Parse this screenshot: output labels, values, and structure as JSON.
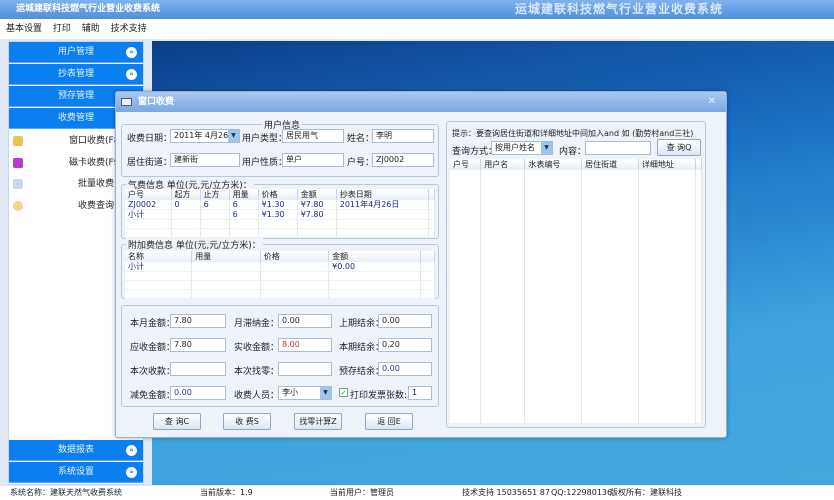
{
  "app": {
    "title": "运城建联科技燃气行业营业收费系统",
    "banner_title": "运城建联科技燃气行业营业收费系统"
  },
  "menu": [
    "基本设置",
    "打印",
    "辅助",
    "技术支持"
  ],
  "sidebar": {
    "sections_top": [
      "用户管理",
      "抄表管理",
      "预存管理",
      "收费管理"
    ],
    "items": [
      {
        "label": "窗口收费(F8)",
        "icon": "pen-icon"
      },
      {
        "label": "磁卡收费(F9)",
        "icon": "card-icon"
      },
      {
        "label": "批量收费",
        "icon": "document-icon"
      },
      {
        "label": "收费查询",
        "icon": "chat-icon"
      }
    ],
    "sections_bottom": [
      "数据报表",
      "系统设置"
    ],
    "accent": "#0a7ff0"
  },
  "dialog": {
    "title": "窗口收费",
    "user_info": {
      "title": "用户信息",
      "date_label": "收费日期：",
      "date_value": "2011年 4月26日",
      "type_label": "用户类型：",
      "type_value": "居民用气",
      "name_label": "姓名：",
      "name_value": "李明",
      "street_label": "居住街道：",
      "street_value": "建新街",
      "nature_label": "用户性质：",
      "nature_value": "单户",
      "account_label": "户号：",
      "account_value": "ZJ0002"
    },
    "gas_fee": {
      "title": "气费信息 单位(元,元/立方米)：",
      "columns": [
        "户号",
        "起方",
        "止方",
        "用量",
        "价格",
        "金额",
        "抄表日期"
      ],
      "rows": [
        [
          "ZJ0002",
          "0",
          "6",
          "6",
          "¥1.30",
          "¥7.80",
          "2011年4月26日"
        ],
        [
          "小计",
          "",
          "",
          "6",
          "¥1.30",
          "¥7.80",
          ""
        ]
      ]
    },
    "extra_fee": {
      "title": "附加费信息 单位(元,元/立方米)：",
      "columns": [
        "名称",
        "用量",
        "价格",
        "金额"
      ],
      "rows": [
        [
          "小计",
          "",
          "",
          "¥0.00"
        ]
      ]
    },
    "summary": {
      "month_amount_label": "本月金额：",
      "month_amount": "7.80",
      "late_fee_label": "月滞纳金：",
      "late_fee": "0.00",
      "last_balance_label": "上期结余：",
      "last_balance": "0.00",
      "due_label": "应收金额：",
      "due": "7.80",
      "paid_label": "实收金额：",
      "paid": "8.00",
      "this_balance_label": "本期结余：",
      "this_balance": "0.20",
      "received_label": "本次收款：",
      "received": "",
      "change_label": "本次找零：",
      "change": "",
      "prepaid_label": "预存结余：",
      "prepaid": "0.00",
      "discount_label": "减免金额：",
      "discount": "0.00",
      "cashier_label": "收费人员：",
      "cashier": "李小",
      "print_invoice_label": "打印发票",
      "print_invoice": true,
      "copies_label": "张数:",
      "copies": "1"
    },
    "buttons": [
      "查 询C",
      "收 费S",
      "找零计算Z",
      "返 回E"
    ],
    "search": {
      "hint": "提示：要查询居住街道和详细地址中间加入and 如 (勤劳村and三社)",
      "mode_label": "查询方式：",
      "mode_value": "按用户姓名",
      "content_label": "内容：",
      "content_value": "",
      "button": "查 询Q",
      "columns": [
        "户号",
        "用户名",
        "水表编号",
        "居住街道",
        "详细地址"
      ]
    }
  },
  "status": {
    "system": "系统名称：建联天然气收费系统",
    "version": "当前版本：1.9",
    "user": "当前用户：管理员",
    "support": "技术支持  15035651 87",
    "qq": "QQ:122980136",
    "copyright": "版权所有：建联科技"
  }
}
